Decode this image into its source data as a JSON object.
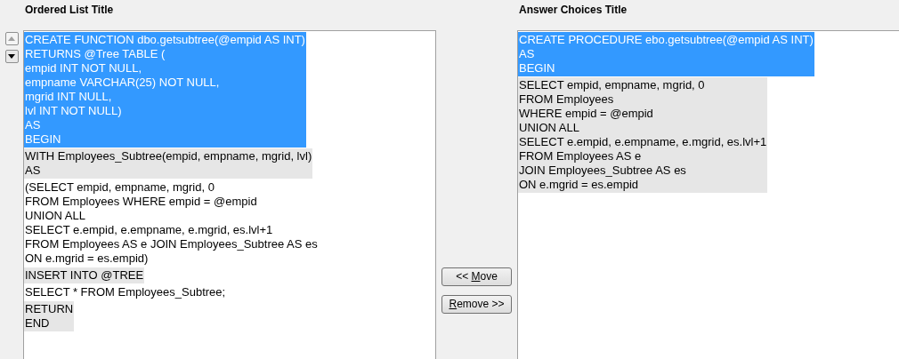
{
  "ordered_list": {
    "title": "Ordered List Title",
    "reorder_buttons": [
      {
        "kind": "up",
        "disabled": true
      },
      {
        "kind": "down",
        "disabled": false
      }
    ],
    "items": [
      {
        "selected": true,
        "lines": [
          "CREATE FUNCTION dbo.getsubtree(@empid AS INT)",
          "RETURNS @Tree TABLE (",
          "empid INT NOT NULL,",
          "empname VARCHAR(25) NOT NULL,",
          "mgrid INT NULL,",
          "lvl INT NOT NULL)",
          "AS",
          "BEGIN"
        ]
      },
      {
        "selected": false,
        "lines": [
          "WITH Employees_Subtree(empid, empname, mgrid, lvl)",
          "AS"
        ]
      },
      {
        "selected": false,
        "lines": [
          "(SELECT empid, empname, mgrid, 0",
          "FROM Employees WHERE empid = @empid",
          "UNION ALL",
          "SELECT e.empid, e.empname, e.mgrid, es.lvl+1",
          "FROM Employees AS e JOIN Employees_Subtree AS es ON e.mgrid = es.empid)"
        ]
      },
      {
        "selected": false,
        "lines": [
          "INSERT INTO @TREE"
        ]
      },
      {
        "selected": false,
        "lines": [
          "SELECT * FROM Employees_Subtree;"
        ]
      },
      {
        "selected": false,
        "lines": [
          "RETURN",
          "END"
        ]
      }
    ]
  },
  "move_buttons": [
    {
      "before": "<< ",
      "key": "M",
      "after": "ove"
    },
    {
      "key": "R",
      "after": "emove >>"
    }
  ],
  "answer_choices": {
    "title": "Answer Choices Title",
    "items": [
      {
        "selected": true,
        "lines": [
          "CREATE PROCEDURE ebo.getsubtree(@empid AS INT)",
          "AS",
          "BEGIN"
        ]
      },
      {
        "selected": false,
        "lines": [
          "SELECT empid, empname, mgrid, 0",
          "FROM Employees",
          "WHERE empid = @empid",
          "UNION ALL",
          "SELECT e.empid, e.empname, e.mgrid, es.lvl+1",
          "FROM Employees AS e",
          "JOIN Employees_Subtree AS es",
          "ON e.mgrid = es.empid"
        ]
      }
    ]
  }
}
